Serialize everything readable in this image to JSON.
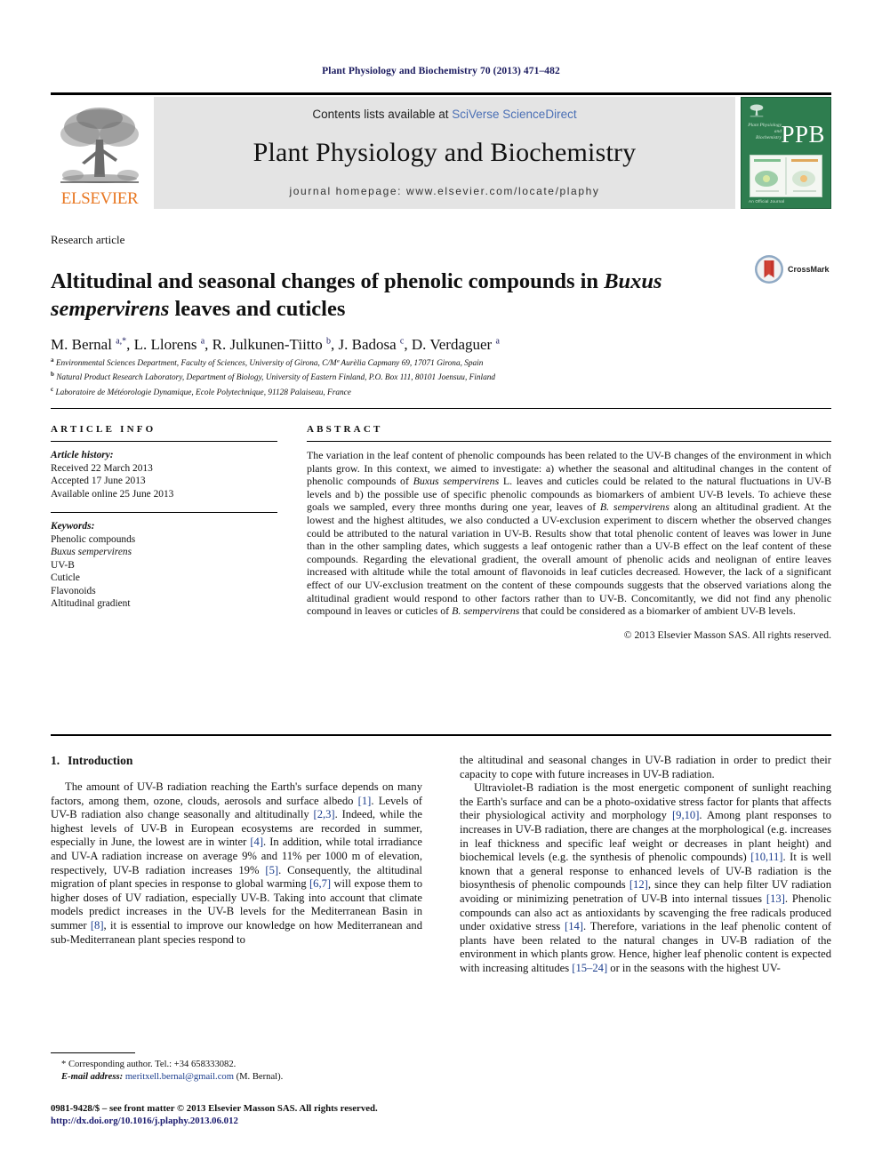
{
  "running_head": "Plant Physiology and Biochemistry 70 (2013) 471–482",
  "masthead": {
    "publisher_name": "ELSEVIER",
    "contents_prefix": "Contents lists available at ",
    "contents_link": "SciVerse ScienceDirect",
    "journal_title": "Plant Physiology and Biochemistry",
    "homepage_label": "journal homepage: www.elsevier.com/locate/plaphy",
    "cover_acronym": "PPB",
    "cover_subtitle": "Plant Physiology and Biochemistry",
    "cover_footer": "An Official Journal"
  },
  "article": {
    "type": "Research article",
    "title_part1": "Altitudinal and seasonal changes of phenolic compounds in ",
    "title_italic": "Buxus sempervirens",
    "title_part2": " leaves and cuticles",
    "crossmark_label": "CrossMark",
    "authors": "M. Bernal, L. Llorens, R. Julkunen-Tiitto, J. Badosa, D. Verdaguer",
    "affiliations": [
      "Environmental Sciences Department, Faculty of Sciences, University of Girona, C/Mª Aurèlia Capmany 69, 17071 Girona, Spain",
      "Natural Product Research Laboratory, Department of Biology, University of Eastern Finland, P.O. Box 111, 80101 Joensuu, Finland",
      "Laboratoire de Météorologie Dynamique, Ecole Polytechnique, 91128 Palaiseau, France"
    ]
  },
  "article_info": {
    "heading": "ARTICLE INFO",
    "history_label": "Article history:",
    "history": [
      "Received 22 March 2013",
      "Accepted 17 June 2013",
      "Available online 25 June 2013"
    ],
    "keywords_label": "Keywords:",
    "keywords": [
      "Phenolic compounds",
      "Buxus sempervirens",
      "UV-B",
      "Cuticle",
      "Flavonoids",
      "Altitudinal gradient"
    ]
  },
  "abstract": {
    "heading": "ABSTRACT",
    "text": "The variation in the leaf content of phenolic compounds has been related to the UV-B changes of the environment in which plants grow. In this context, we aimed to investigate: a) whether the seasonal and altitudinal changes in the content of phenolic compounds of Buxus sempervirens L. leaves and cuticles could be related to the natural fluctuations in UV-B levels and b) the possible use of specific phenolic compounds as biomarkers of ambient UV-B levels. To achieve these goals we sampled, every three months during one year, leaves of B. sempervirens along an altitudinal gradient. At the lowest and the highest altitudes, we also conducted a UV-exclusion experiment to discern whether the observed changes could be attributed to the natural variation in UV-B. Results show that total phenolic content of leaves was lower in June than in the other sampling dates, which suggests a leaf ontogenic rather than a UV-B effect on the leaf content of these compounds. Regarding the elevational gradient, the overall amount of phenolic acids and neolignan of entire leaves increased with altitude while the total amount of flavonoids in leaf cuticles decreased. However, the lack of a significant effect of our UV-exclusion treatment on the content of these compounds suggests that the observed variations along the altitudinal gradient would respond to other factors rather than to UV-B. Concomitantly, we did not find any phenolic compound in leaves or cuticles of B. sempervirens that could be considered as a biomarker of ambient UV-B levels.",
    "copyright": "© 2013 Elsevier Masson SAS. All rights reserved."
  },
  "introduction": {
    "number": "1.",
    "heading": "Introduction",
    "left_paragraph_1": "The amount of UV-B radiation reaching the Earth's surface depends on many factors, among them, ozone, clouds, aerosols and surface albedo [1]. Levels of UV-B radiation also change seasonally and altitudinally [2,3]. Indeed, while the highest levels of UV-B in European ecosystems are recorded in summer, especially in June, the lowest are in winter [4]. In addition, while total irradiance and UV-A radiation increase on average 9% and 11% per 1000 m of elevation, respectively, UV-B radiation increases 19% [5]. Consequently, the altitudinal migration of plant species in response to global warming [6,7] will expose them to higher doses of UV radiation, especially UV-B. Taking into account that climate models predict increases in the UV-B levels for the Mediterranean Basin in summer [8], it is essential to improve our knowledge on how Mediterranean and sub-Mediterranean plant species respond to",
    "right_paragraph_1": "the altitudinal and seasonal changes in UV-B radiation in order to predict their capacity to cope with future increases in UV-B radiation.",
    "right_paragraph_2": "Ultraviolet-B radiation is the most energetic component of sunlight reaching the Earth's surface and can be a photo-oxidative stress factor for plants that affects their physiological activity and morphology [9,10]. Among plant responses to increases in UV-B radiation, there are changes at the morphological (e.g. increases in leaf thickness and specific leaf weight or decreases in plant height) and biochemical levels (e.g. the synthesis of phenolic compounds) [10,11]. It is well known that a general response to enhanced levels of UV-B radiation is the biosynthesis of phenolic compounds [12], since they can help filter UV radiation avoiding or minimizing penetration of UV-B into internal tissues [13]. Phenolic compounds can also act as antioxidants by scavenging the free radicals produced under oxidative stress [14]. Therefore, variations in the leaf phenolic content of plants have been related to the natural changes in UV-B radiation of the environment in which plants grow. Hence, higher leaf phenolic content is expected with increasing altitudes [15–24] or in the seasons with the highest UV-"
  },
  "footnote": {
    "corresponding": "* Corresponding author. Tel.: +34 658333082.",
    "email_label": "E-mail address:",
    "email": "meritxell.bernal@gmail.com",
    "email_suffix": " (M. Bernal)."
  },
  "bottom": {
    "front_matter": "0981-9428/$ – see front matter © 2013 Elsevier Masson SAS. All rights reserved.",
    "doi": "http://dx.doi.org/10.1016/j.plaphy.2013.06.012"
  },
  "colors": {
    "link_blue": "#1a3c8c",
    "navy": "#1a1a5e",
    "elsevier_orange": "#e87722",
    "cover_green": "#2e7d4f",
    "band_gray": "#e4e4e4"
  }
}
